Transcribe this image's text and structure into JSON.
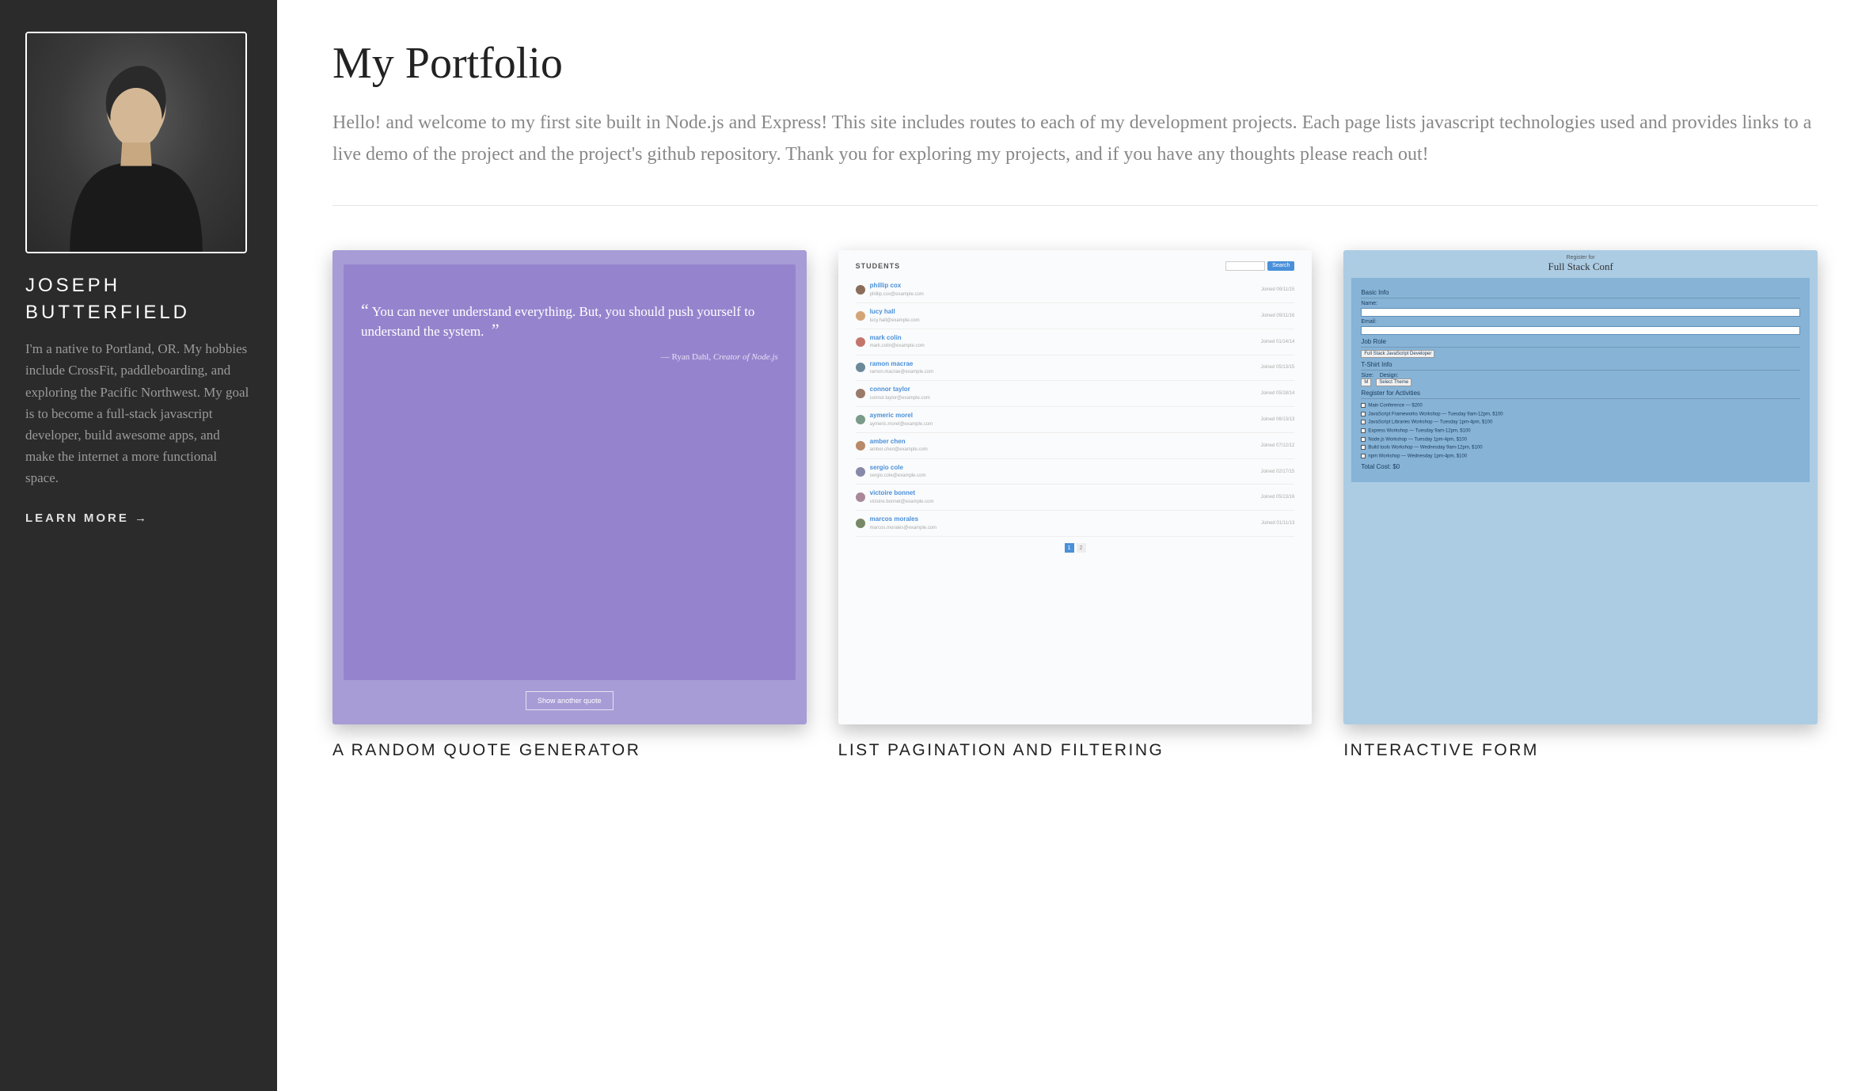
{
  "sidebar": {
    "name": "JOSEPH BUTTERFIELD",
    "bio": "I'm a native to Portland, OR. My hobbies include CrossFit, paddleboarding, and exploring the Pacific Northwest. My goal is to become a full-stack javascript developer, build awesome apps, and make the internet a more functional space.",
    "learn_more": "LEARN MORE →"
  },
  "main": {
    "title": "My Portfolio",
    "intro": "Hello! and welcome to my first site built in Node.js and Express! This site includes routes to each of my development projects. Each page lists javascript technologies used and provides links to a live demo of the project and the project's github repository. Thank you for exploring my projects, and if you have any thoughts please reach out!"
  },
  "projects": [
    {
      "title": "A RANDOM QUOTE GENERATOR"
    },
    {
      "title": "LIST PAGINATION AND FILTERING"
    },
    {
      "title": "INTERACTIVE FORM"
    }
  ],
  "thumb_quote": {
    "text": "You can never understand everything. But, you should push yourself to understand the system.",
    "author": "— Ryan Dahl,",
    "author_title": "Creator of Node.js",
    "button": "Show another quote"
  },
  "thumb_students": {
    "heading": "STUDENTS",
    "search_btn": "Search",
    "rows": [
      {
        "name": "phillip cox",
        "email": "phillip.cox@example.com",
        "date": "Joined 09/11/15"
      },
      {
        "name": "lucy hall",
        "email": "lucy.hall@example.com",
        "date": "Joined 09/11/16"
      },
      {
        "name": "mark colin",
        "email": "mark.colin@example.com",
        "date": "Joined 01/14/14"
      },
      {
        "name": "ramon macrae",
        "email": "ramon.macrae@example.com",
        "date": "Joined 05/13/15"
      },
      {
        "name": "connor taylor",
        "email": "connor.taylor@example.com",
        "date": "Joined 05/18/14"
      },
      {
        "name": "aymeric morel",
        "email": "aymeric.morel@example.com",
        "date": "Joined 06/13/13"
      },
      {
        "name": "amber chen",
        "email": "amber.chen@example.com",
        "date": "Joined 07/12/12"
      },
      {
        "name": "sergio cole",
        "email": "sergio.cole@example.com",
        "date": "Joined 02/17/15"
      },
      {
        "name": "victoire bonnet",
        "email": "victoire.bonnet@example.com",
        "date": "Joined 05/13/16"
      },
      {
        "name": "marcos morales",
        "email": "marcos.morales@example.com",
        "date": "Joined 01/11/13"
      }
    ],
    "pages": [
      "1",
      "2"
    ]
  },
  "thumb_form": {
    "pretitle": "Register for",
    "title": "Full Stack Conf",
    "basic_info": "Basic Info",
    "name_label": "Name:",
    "email_label": "Email:",
    "job_role": "Job Role",
    "job_role_value": "Full Stack JavaScript Developer",
    "tshirt": "T-Shirt Info",
    "size_label": "Size:",
    "size_value": "M",
    "design_label": "Design:",
    "design_value": "Select Theme",
    "activities": "Register for Activities",
    "activity_list": [
      "Main Conference — $200",
      "JavaScript Frameworks Workshop — Tuesday 9am-12pm, $100",
      "JavaScript Libraries Workshop — Tuesday 1pm-4pm, $100",
      "Express Workshop — Tuesday 9am-12pm, $100",
      "Node.js Workshop — Tuesday 1pm-4pm, $100",
      "Build tools Workshop — Wednesday 9am-12pm, $100",
      "npm Workshop — Wednesday 1pm-4pm, $100"
    ],
    "total": "Total Cost: $0"
  }
}
